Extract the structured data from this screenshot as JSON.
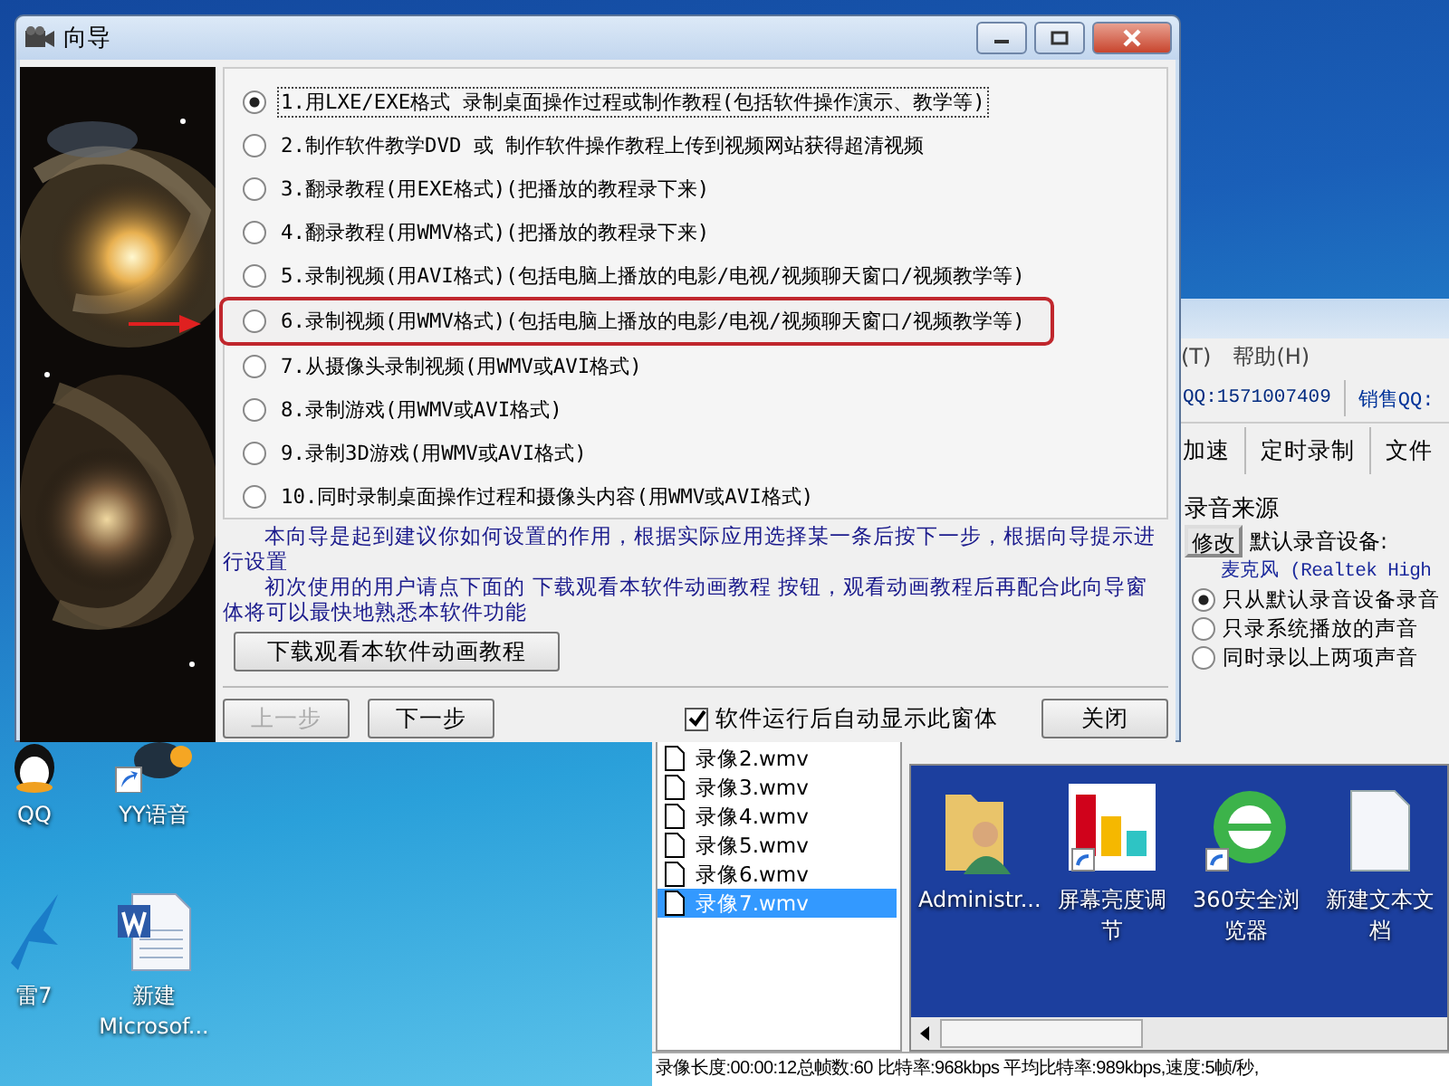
{
  "wizard": {
    "title": "向导",
    "options": [
      {
        "label": "1.用LXE/EXE格式 录制桌面操作过程或制作教程(包括软件操作演示、教学等)",
        "selected": true,
        "highlighted": false
      },
      {
        "label": "2.制作软件教学DVD 或 制作软件操作教程上传到视频网站获得超清视频",
        "selected": false,
        "highlighted": false
      },
      {
        "label": "3.翻录教程(用EXE格式)(把播放的教程录下来)",
        "selected": false,
        "highlighted": false
      },
      {
        "label": "4.翻录教程(用WMV格式)(把播放的教程录下来)",
        "selected": false,
        "highlighted": false
      },
      {
        "label": "5.录制视频(用AVI格式)(包括电脑上播放的电影/电视/视频聊天窗口/视频教学等)",
        "selected": false,
        "highlighted": false
      },
      {
        "label": "6.录制视频(用WMV格式)(包括电脑上播放的电影/电视/视频聊天窗口/视频教学等)",
        "selected": false,
        "highlighted": true
      },
      {
        "label": "7.从摄像头录制视频(用WMV或AVI格式)",
        "selected": false,
        "highlighted": false
      },
      {
        "label": "8.录制游戏(用WMV或AVI格式)",
        "selected": false,
        "highlighted": false
      },
      {
        "label": "9.录制3D游戏(用WMV或AVI格式)",
        "selected": false,
        "highlighted": false
      },
      {
        "label": "10.同时录制桌面操作过程和摄像头内容(用WMV或AVI格式)",
        "selected": false,
        "highlighted": false
      }
    ],
    "intro": [
      "本向导是起到建议你如何设置的作用，根据实际应用选择某一条后按下一步，根据向导提示进行设置",
      "初次使用的用户请点下面的 下载观看本软件动画教程 按钮，观看动画教程后再配合此向导窗体将可以最快地熟悉本软件功能"
    ],
    "download_button": "下载观看本软件动画教程",
    "nav_buttons": [
      {
        "label": "上一步",
        "disabled": true
      },
      {
        "label": "下一步",
        "disabled": false
      }
    ],
    "autoshow": {
      "label": "软件运行后自动显示此窗体",
      "checked": true
    },
    "close_button": "关闭"
  },
  "recorder": {
    "menu": [
      "(T)",
      "帮助(H)"
    ],
    "contacts": [
      "QQ:1571007409",
      "销售QQ:"
    ],
    "toolbar": [
      "加速",
      "定时录制",
      "文件"
    ],
    "audio": {
      "title": "录音来源",
      "change_button": "修改",
      "device_label": "默认录音设备:",
      "device": "麦克风 (Realtek High",
      "modes": [
        {
          "label": "只从默认录音设备录音",
          "selected": true
        },
        {
          "label": "只录系统播放的声音",
          "selected": false
        },
        {
          "label": "同时录以上两项声音",
          "selected": false
        }
      ]
    },
    "files": [
      {
        "name": "录像2.wmv",
        "selected": false
      },
      {
        "name": "录像3.wmv",
        "selected": false
      },
      {
        "name": "录像4.wmv",
        "selected": false
      },
      {
        "name": "录像5.wmv",
        "selected": false
      },
      {
        "name": "录像6.wmv",
        "selected": false
      },
      {
        "name": "录像7.wmv",
        "selected": true
      }
    ],
    "preview_icons": [
      {
        "label": "Administr...",
        "kind": "user-folder"
      },
      {
        "label": "屏幕亮度调节",
        "kind": "bars"
      },
      {
        "label": "360安全浏览器",
        "kind": "browser"
      },
      {
        "label": "新建文本文档",
        "kind": "document"
      }
    ],
    "status": "录像长度:00:00:12总帧数:60 比特率:968kbps 平均比特率:989kbps,速度:5帧/秒,"
  },
  "desktop_icons": [
    {
      "label": "QQ",
      "kind": "penguin"
    },
    {
      "label": "YY语音",
      "kind": "yy"
    },
    {
      "label": "雷7",
      "kind": "bird"
    },
    {
      "label": "新建 Microsof...",
      "kind": "word"
    }
  ]
}
